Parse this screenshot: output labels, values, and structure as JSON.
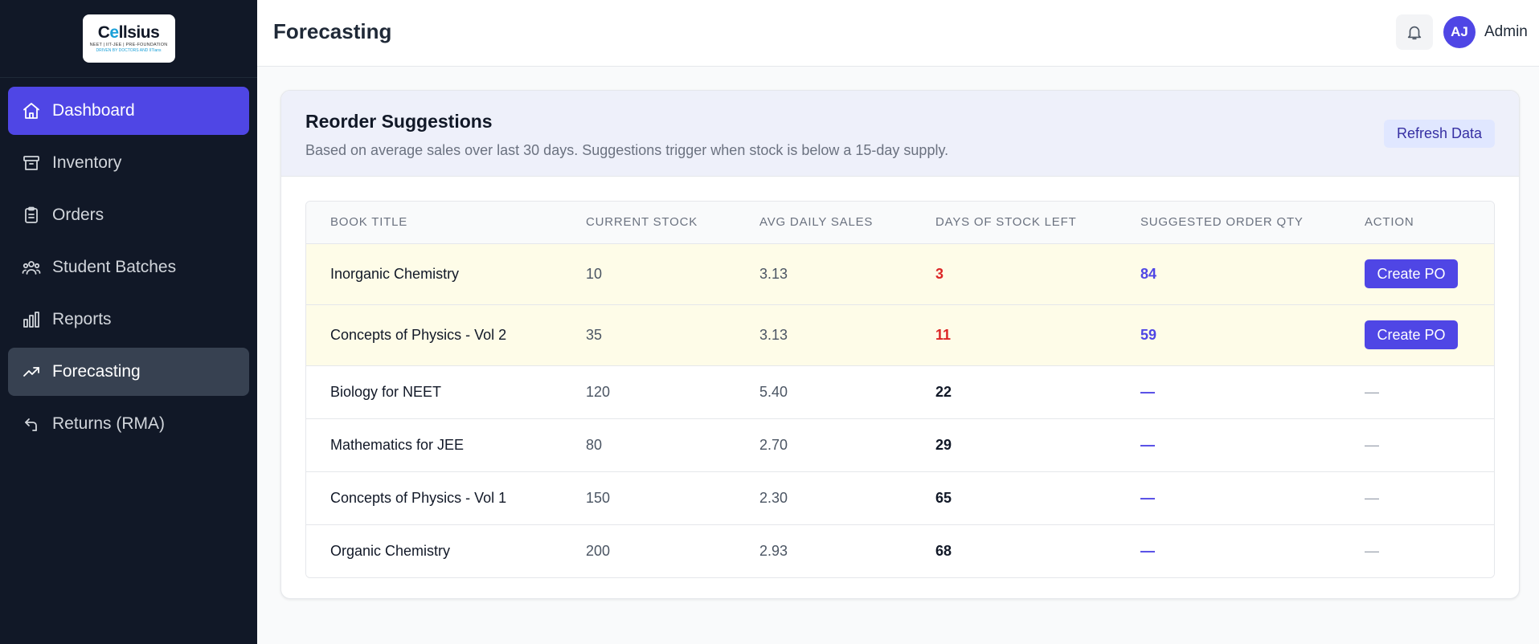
{
  "brand": {
    "logo_word_a": "C",
    "logo_word_o": "e",
    "logo_word_b": "llsius",
    "logo_tagline": "NEET | IIT-JEE | PRE-FOUNDATION",
    "logo_tagline2": "DRIVEN BY DOCTORS AND IITians"
  },
  "sidebar": {
    "items": [
      {
        "label": "Dashboard",
        "icon": "home-icon"
      },
      {
        "label": "Inventory",
        "icon": "archive-icon"
      },
      {
        "label": "Orders",
        "icon": "clipboard-icon"
      },
      {
        "label": "Student Batches",
        "icon": "users-icon"
      },
      {
        "label": "Reports",
        "icon": "bar-chart-icon"
      },
      {
        "label": "Forecasting",
        "icon": "trending-up-icon"
      },
      {
        "label": "Returns (RMA)",
        "icon": "return-icon"
      }
    ]
  },
  "header": {
    "title": "Forecasting",
    "avatar_initials": "AJ",
    "user_name": "Admin"
  },
  "card": {
    "title": "Reorder Suggestions",
    "subtitle": "Based on average sales over last 30 days. Suggestions trigger when stock is below a 15-day supply.",
    "refresh_label": "Refresh Data"
  },
  "table": {
    "columns": [
      "BOOK TITLE",
      "CURRENT STOCK",
      "AVG DAILY SALES",
      "DAYS OF STOCK LEFT",
      "SUGGESTED ORDER QTY",
      "ACTION"
    ],
    "rows": [
      {
        "title": "Inorganic Chemistry",
        "stock": "10",
        "avg": "3.13",
        "days": "3",
        "qty": "84",
        "action": "Create PO"
      },
      {
        "title": "Concepts of Physics - Vol 2",
        "stock": "35",
        "avg": "3.13",
        "days": "11",
        "qty": "59",
        "action": "Create PO"
      },
      {
        "title": "Biology for NEET",
        "stock": "120",
        "avg": "5.40",
        "days": "22",
        "qty": "—",
        "action": "—"
      },
      {
        "title": "Mathematics for JEE",
        "stock": "80",
        "avg": "2.70",
        "days": "29",
        "qty": "—",
        "action": "—"
      },
      {
        "title": "Concepts of Physics - Vol 1",
        "stock": "150",
        "avg": "2.30",
        "days": "65",
        "qty": "—",
        "action": "—"
      },
      {
        "title": "Organic Chemistry",
        "stock": "200",
        "avg": "2.93",
        "days": "68",
        "qty": "—",
        "action": "—"
      }
    ]
  },
  "colors": {
    "sidebar_bg": "#111827",
    "accent": "#4f46e5",
    "danger": "#dc2626",
    "highlight_row": "#fefce8"
  }
}
